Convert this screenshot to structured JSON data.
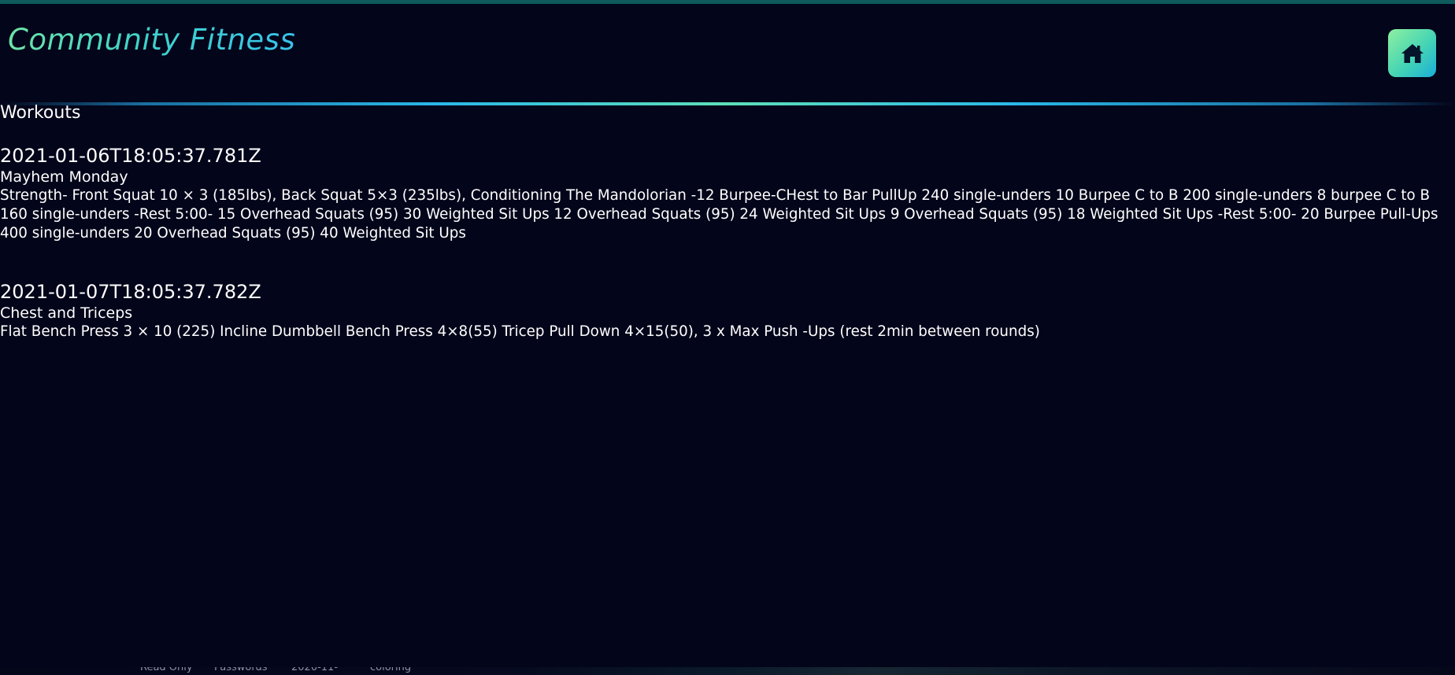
{
  "header": {
    "brand": "Community Fitness",
    "home_icon": "home-icon"
  },
  "section_title": "Workouts",
  "workouts": [
    {
      "date": "2021-01-06T18:05:37.781Z",
      "name": "Mayhem Monday",
      "description": "Strength- Front Squat 10 × 3 (185lbs), Back Squat 5×3 (235lbs), Conditioning The Mandolorian -12 Burpee-CHest to Bar PullUp 240 single-unders 10 Burpee C to B 200 single-unders 8 burpee C to B 160 single-unders -Rest 5:00- 15 Overhead Squats (95) 30 Weighted Sit Ups 12 Overhead Squats (95) 24 Weighted Sit Ups 9 Overhead Squats (95) 18 Weighted Sit Ups -Rest 5:00- 20 Burpee Pull-Ups 400 single-unders 20 Overhead Squats (95) 40 Weighted Sit Ups"
    },
    {
      "date": "2021-01-07T18:05:37.782Z",
      "name": "Chest and Triceps",
      "description": "Flat Bench Press 3 × 10 (225) Incline Dumbbell Bench Press 4×8(55) Tricep Pull Down 4×15(50), 3 x Max Push -Ups (rest 2min between rounds)"
    }
  ],
  "taskbar": {
    "items": [
      "Read Only",
      "Passwords",
      "2020-11-",
      "coloring"
    ]
  },
  "colors": {
    "background": "#03051a",
    "brand_gradient_start": "#6ee3a6",
    "brand_gradient_end": "#38c2ea",
    "top_bar": "#0e5a5c"
  }
}
